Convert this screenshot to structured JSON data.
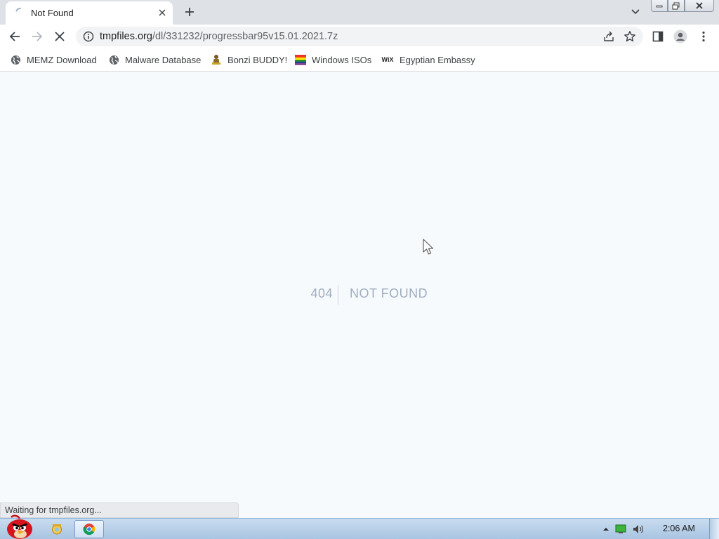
{
  "browser": {
    "tab": {
      "title": "Not Found"
    },
    "address_bar": {
      "url_host": "tmpfiles.org",
      "url_path": "/dl/331232/progressbar95v15.01.2021.7z"
    },
    "bookmarks": [
      {
        "label": "MEMZ Download",
        "icon": "globe-icon"
      },
      {
        "label": "Malware Database",
        "icon": "globe-icon"
      },
      {
        "label": "Bonzi BUDDY!",
        "icon": "bonzi-icon"
      },
      {
        "label": "Windows ISOs",
        "icon": "rainbow-flag-icon"
      },
      {
        "label": "Egyptian Embassy",
        "icon": "wix-icon",
        "icon_text": "WiX"
      }
    ],
    "status_text": "Waiting for tmpfiles.org..."
  },
  "page": {
    "error_code": "404",
    "error_message": "NOT FOUND"
  },
  "taskbar": {
    "clock": "2:06 AM"
  },
  "colors": {
    "page_background": "#f7fafc",
    "error_text": "#a0aec0",
    "tabstrip": "#dee1e6",
    "taskbar": "#b9d1ea"
  }
}
